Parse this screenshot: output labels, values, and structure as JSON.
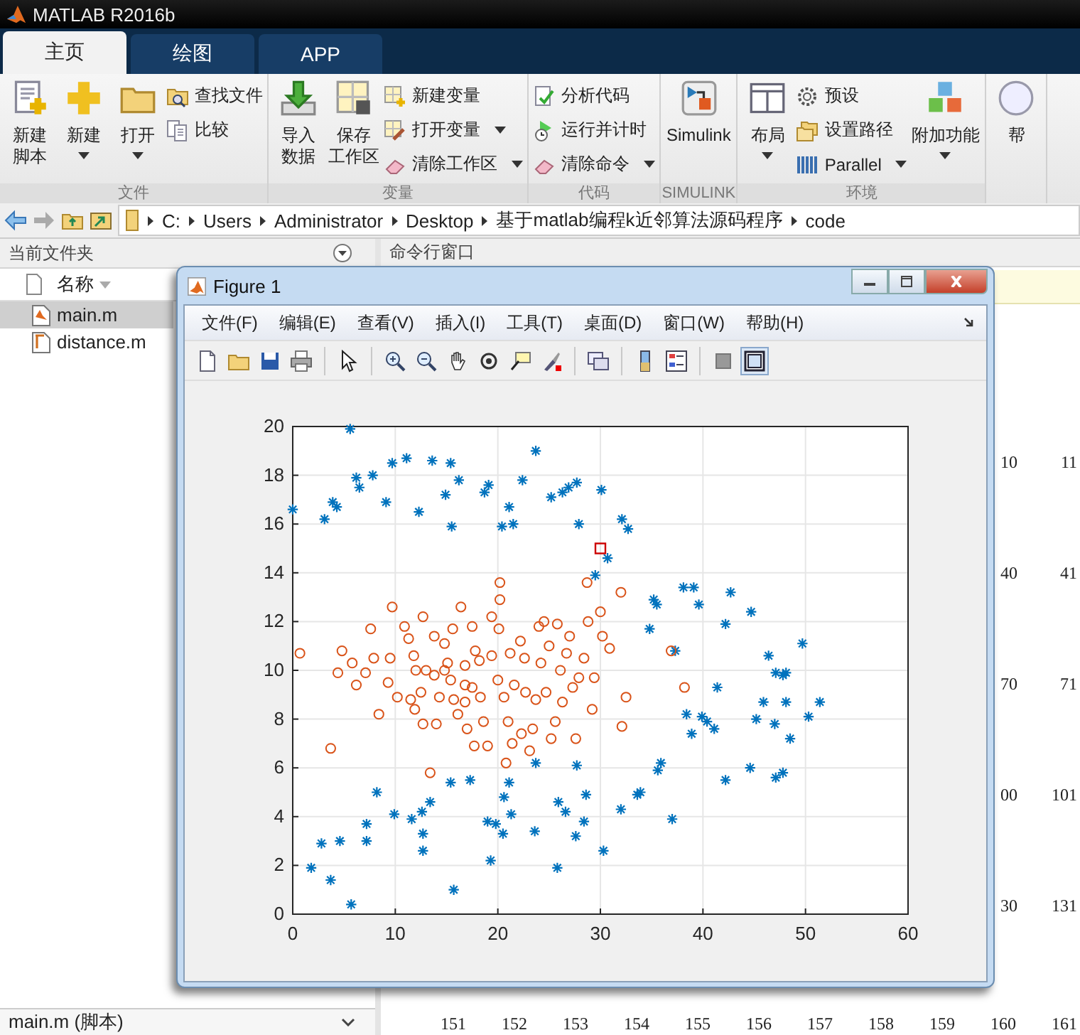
{
  "window": {
    "title": "MATLAB R2016b"
  },
  "tabs": [
    {
      "label": "主页",
      "selected": true
    },
    {
      "label": "绘图",
      "selected": false
    },
    {
      "label": "APP",
      "selected": false
    }
  ],
  "ribbon": {
    "groups": [
      {
        "label": "文件",
        "items": [
          {
            "kind": "large",
            "lines": [
              "新建",
              "脚本"
            ],
            "dropdown": false
          },
          {
            "kind": "large",
            "lines": [
              "新建"
            ],
            "dropdown": true
          },
          {
            "kind": "large",
            "lines": [
              "打开"
            ],
            "dropdown": true
          },
          {
            "kind": "stack",
            "items": [
              {
                "label": "查找文件",
                "dropdown": false
              },
              {
                "label": "比较",
                "dropdown": false
              }
            ]
          }
        ]
      },
      {
        "label": "变量",
        "items": [
          {
            "kind": "large",
            "lines": [
              "导入",
              "数据"
            ],
            "dropdown": false
          },
          {
            "kind": "large",
            "lines": [
              "保存",
              "工作区"
            ],
            "dropdown": false
          },
          {
            "kind": "stack",
            "items": [
              {
                "label": "新建变量",
                "dropdown": false
              },
              {
                "label": "打开变量",
                "dropdown": true
              },
              {
                "label": "清除工作区",
                "dropdown": true
              }
            ]
          }
        ]
      },
      {
        "label": "代码",
        "items": [
          {
            "kind": "stack",
            "items": [
              {
                "label": "分析代码",
                "dropdown": false
              },
              {
                "label": "运行并计时",
                "dropdown": false
              },
              {
                "label": "清除命令",
                "dropdown": true
              }
            ]
          }
        ]
      },
      {
        "label": "SIMULINK",
        "items": [
          {
            "kind": "large",
            "lines": [
              "Simulink"
            ],
            "dropdown": false
          }
        ]
      },
      {
        "label": "环境",
        "items": [
          {
            "kind": "large",
            "lines": [
              "布局"
            ],
            "dropdown": true
          },
          {
            "kind": "stack",
            "items": [
              {
                "label": "预设",
                "dropdown": false
              },
              {
                "label": "设置路径",
                "dropdown": false
              },
              {
                "label": "Parallel",
                "dropdown": true
              }
            ]
          },
          {
            "kind": "large",
            "lines": [
              "附加功能"
            ],
            "dropdown": true
          }
        ]
      },
      {
        "items": [
          {
            "kind": "large",
            "lines": [
              "帮"
            ],
            "dropdown": false
          }
        ]
      }
    ]
  },
  "address_bar": {
    "path": [
      "C:",
      "Users",
      "Administrator",
      "Desktop",
      "基于matlab编程k近邻算法源码程序",
      "code"
    ]
  },
  "file_browser": {
    "title": "当前文件夹",
    "column": "名称",
    "files": [
      {
        "name": "main.m",
        "selected": true,
        "kind": "script"
      },
      {
        "name": "distance.m",
        "selected": false,
        "kind": "function"
      }
    ],
    "details": "main.m  (脚本)"
  },
  "command_window": {
    "title": "命令行窗口",
    "output_rows": [
      [
        "10",
        "11"
      ],
      [
        "40",
        "41"
      ],
      [
        "70",
        "71"
      ],
      [
        "00",
        "101"
      ],
      [
        "30",
        "131"
      ],
      [
        "151",
        "152",
        "153",
        "154",
        "155",
        "156",
        "157",
        "158",
        "159",
        "160",
        "161"
      ]
    ]
  },
  "figure": {
    "title": "Figure 1",
    "menu": [
      "文件(F)",
      "编辑(E)",
      "查看(V)",
      "插入(I)",
      "工具(T)",
      "桌面(D)",
      "窗口(W)",
      "帮助(H)"
    ],
    "toolbar_groups": [
      {
        "buttons": [
          {
            "selected": false
          },
          {
            "selected": false
          },
          {
            "selected": false
          },
          {
            "selected": false
          }
        ]
      },
      {
        "buttons": [
          {
            "selected": false
          }
        ]
      },
      {
        "buttons": [
          {
            "selected": false
          },
          {
            "selected": false
          },
          {
            "selected": false
          },
          {
            "selected": false
          },
          {
            "selected": false
          },
          {
            "selected": false
          }
        ]
      },
      {
        "buttons": [
          {
            "selected": false
          }
        ]
      },
      {
        "buttons": [
          {
            "selected": false
          },
          {
            "selected": false
          }
        ]
      },
      {
        "buttons": [
          {
            "selected": false
          },
          {
            "selected": true
          }
        ]
      }
    ],
    "chart_data": {
      "type": "scatter",
      "grid": true,
      "xlim": [
        0,
        60
      ],
      "ylim": [
        0,
        20
      ],
      "xticks": [
        0,
        10,
        20,
        30,
        40,
        50,
        60
      ],
      "yticks": [
        0,
        2,
        4,
        6,
        8,
        10,
        12,
        14,
        16,
        18,
        20
      ],
      "series": [
        {
          "color": "#0072bd",
          "marker": "cross",
          "x": [
            0,
            3.1,
            3.9,
            4.3,
            5.6,
            6.2,
            6.5,
            7.8,
            9.1,
            9.7,
            11.1,
            12.3,
            13.6,
            15.4,
            14.9,
            15.5,
            16.2,
            18.7,
            19.1,
            20.4,
            21.1,
            21.5,
            22.4,
            23.7,
            25.2,
            26.3,
            26.9,
            27.7,
            30.1,
            27.9,
            32.1,
            32.7,
            30.7,
            29.5,
            35.2,
            35.5,
            34.8,
            38.1,
            39.1,
            39.6,
            42.7,
            44.7,
            42.2,
            37.3,
            49.7,
            46.4,
            47.1,
            48.1,
            47.8,
            41.4,
            45.9,
            48.1,
            51.4,
            38.4,
            39.9,
            40.4,
            38.9,
            41.1,
            45.2,
            47,
            50.3,
            48.5,
            42.2,
            44.6,
            47.1,
            47.8,
            35.9,
            35.6,
            33.9,
            33.6,
            32,
            37,
            30.3,
            28.6,
            27.7,
            28.4,
            27.6,
            25.9,
            26.6,
            25.8,
            23.7,
            23.6,
            21.1,
            20.6,
            21.3,
            20.5,
            19.8,
            19,
            19.3,
            17.3,
            15.4,
            13.4,
            12.7,
            12.6,
            11.6,
            12.7,
            9.9,
            8.2,
            7.2,
            7.2,
            4.6,
            2.8,
            1.8,
            3.7,
            5.7,
            15.7
          ],
          "values": [
            16.6,
            16.2,
            16.9,
            16.7,
            19.9,
            17.9,
            17.5,
            18,
            16.9,
            18.5,
            18.7,
            16.5,
            18.6,
            18.5,
            17.2,
            15.9,
            17.8,
            17.3,
            17.6,
            15.9,
            16.7,
            16,
            17.8,
            19,
            17.1,
            17.3,
            17.5,
            17.7,
            17.4,
            16,
            16.2,
            15.8,
            14.6,
            13.9,
            12.9,
            12.7,
            11.7,
            13.4,
            13.4,
            12.7,
            13.2,
            12.4,
            11.9,
            10.8,
            11.1,
            10.6,
            9.9,
            9.9,
            9.8,
            9.3,
            8.7,
            8.7,
            8.7,
            8.2,
            8.1,
            7.9,
            7.4,
            7.6,
            8,
            7.8,
            8.1,
            7.2,
            5.5,
            6,
            5.6,
            5.8,
            6.2,
            5.9,
            5,
            4.9,
            4.3,
            3.9,
            2.6,
            4.9,
            6.1,
            3.8,
            3.2,
            4.6,
            4.2,
            1.9,
            6.2,
            3.4,
            5.4,
            4.8,
            4.1,
            3.3,
            3.7,
            3.8,
            2.2,
            5.5,
            5.4,
            4.6,
            3.3,
            4.2,
            3.9,
            2.6,
            4.1,
            5,
            3.7,
            3,
            3,
            2.9,
            1.9,
            1.4,
            0.4,
            1
          ]
        },
        {
          "color": "#d95319",
          "marker": "circle",
          "x": [
            0.7,
            3.7,
            4.8,
            4.4,
            5.8,
            6.2,
            7.1,
            7.6,
            7.9,
            8.4,
            9.7,
            9.3,
            9.5,
            10.2,
            10.9,
            11.3,
            11.8,
            12,
            11.5,
            11.9,
            12.5,
            13,
            12.7,
            13.4,
            12.7,
            13.8,
            13.8,
            14.3,
            14,
            14.8,
            15.1,
            15.6,
            15.4,
            15.7,
            16.1,
            16.4,
            16.8,
            16.8,
            16.8,
            17,
            17.5,
            17.8,
            17.5,
            18.2,
            18.3,
            18.6,
            19,
            19.4,
            19.4,
            20,
            20.2,
            20.2,
            20.1,
            20.6,
            21,
            20.8,
            21.2,
            21.4,
            21.6,
            22.2,
            22.3,
            22.6,
            22.7,
            23.1,
            23.4,
            23.7,
            24,
            24.2,
            24.5,
            24.7,
            25,
            25.2,
            25.6,
            25.8,
            26.1,
            26.3,
            26.7,
            27,
            27.3,
            27.6,
            27.9,
            28.4,
            28.7,
            28.8,
            29.2,
            29.4,
            30,
            30.2,
            30.9,
            32,
            32.1,
            32.5,
            36.9,
            38.2,
            17.7,
            14.8
          ],
          "values": [
            10.7,
            6.8,
            10.8,
            9.9,
            10.3,
            9.4,
            9.9,
            11.7,
            10.5,
            8.2,
            12.6,
            9.5,
            10.5,
            8.9,
            11.8,
            11.3,
            10.6,
            10,
            8.8,
            8.4,
            9.1,
            10,
            7.8,
            5.8,
            12.2,
            11.4,
            9.8,
            8.9,
            7.8,
            11.1,
            10.3,
            11.7,
            9.6,
            8.8,
            8.2,
            12.6,
            10.2,
            9.4,
            8.7,
            7.6,
            11.8,
            10.8,
            9.3,
            10.4,
            8.9,
            7.9,
            6.9,
            12.2,
            10.6,
            9.6,
            13.6,
            12.9,
            11.7,
            8.9,
            7.9,
            6.2,
            10.7,
            7,
            9.4,
            11.2,
            7.4,
            10.5,
            9.1,
            6.7,
            7.6,
            8.8,
            11.8,
            10.3,
            12,
            9.1,
            11,
            7.2,
            7.9,
            11.9,
            10,
            8.7,
            10.7,
            11.4,
            9.3,
            7.2,
            9.7,
            10.5,
            13.6,
            12,
            8.4,
            9.7,
            12.4,
            11.4,
            10.9,
            13.2,
            7.7,
            8.9,
            10.8,
            9.3,
            6.9,
            10
          ]
        },
        {
          "color": "#cc0000",
          "marker": "square",
          "x": [
            30
          ],
          "values": [
            15
          ]
        }
      ]
    }
  }
}
